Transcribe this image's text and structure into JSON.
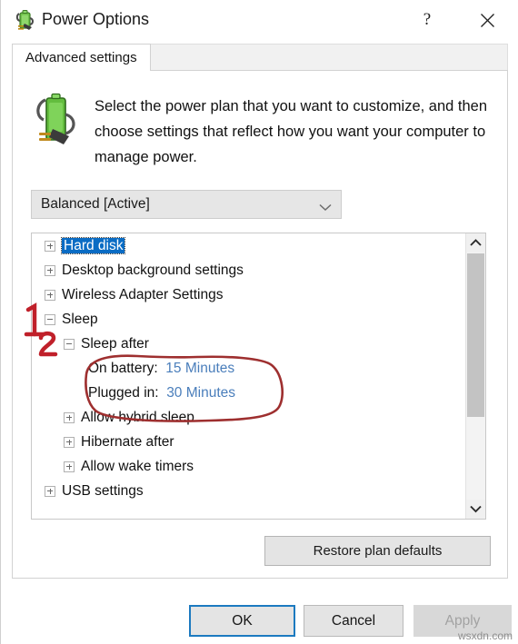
{
  "window": {
    "title": "Power Options",
    "icon": "power-plug-battery-icon",
    "help_label": "?",
    "close_label": "✕"
  },
  "tabs": [
    {
      "label": "Advanced settings",
      "active": true
    }
  ],
  "header": {
    "icon": "battery-plug-icon",
    "description": "Select the power plan that you want to customize, and then choose settings that reflect how you want your computer to manage power."
  },
  "plan_select": {
    "value": "Balanced [Active]",
    "arrow_icon": "chevron-down-icon"
  },
  "tree": {
    "rows": [
      {
        "type": "group",
        "indent": 0,
        "expander": "plus",
        "label": "Hard disk",
        "selected": true
      },
      {
        "type": "group",
        "indent": 0,
        "expander": "plus",
        "label": "Desktop background settings",
        "selected": false
      },
      {
        "type": "group",
        "indent": 0,
        "expander": "plus",
        "label": "Wireless Adapter Settings",
        "selected": false
      },
      {
        "type": "group",
        "indent": 0,
        "expander": "minus",
        "label": "Sleep",
        "selected": false
      },
      {
        "type": "group",
        "indent": 1,
        "expander": "minus",
        "label": "Sleep after",
        "selected": false
      },
      {
        "type": "setting",
        "indent": 2,
        "name": "On battery:",
        "value": "15 Minutes"
      },
      {
        "type": "setting",
        "indent": 2,
        "name": "Plugged in:",
        "value": "30 Minutes"
      },
      {
        "type": "group",
        "indent": 1,
        "expander": "plus",
        "label": "Allow hybrid sleep",
        "selected": false
      },
      {
        "type": "group",
        "indent": 1,
        "expander": "plus",
        "label": "Hibernate after",
        "selected": false
      },
      {
        "type": "group",
        "indent": 1,
        "expander": "plus",
        "label": "Allow wake timers",
        "selected": false
      },
      {
        "type": "group",
        "indent": 0,
        "expander": "plus",
        "label": "USB settings",
        "selected": false
      }
    ],
    "scrollbar": {
      "up_icon": "chevron-up-icon",
      "down_icon": "chevron-down-icon"
    }
  },
  "buttons": {
    "restore": "Restore plan defaults",
    "ok": "OK",
    "cancel": "Cancel",
    "apply": "Apply"
  },
  "annotations": {
    "marker_one": "1",
    "marker_two": "2",
    "circle_color": "#9e2f2f",
    "marker_color": "#c0202a"
  },
  "watermark": "wsxdn.com"
}
